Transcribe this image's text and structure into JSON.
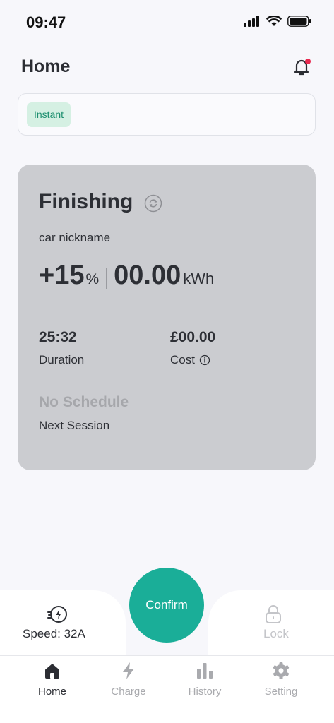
{
  "status_bar": {
    "time": "09:47"
  },
  "header": {
    "title": "Home"
  },
  "mode": {
    "chip_label": "Instant"
  },
  "card": {
    "status": "Finishing",
    "car_nickname": "car nickname",
    "percent_value": "+15",
    "percent_unit": "%",
    "energy_value": "00.00",
    "energy_unit": "kWh",
    "duration_value": "25:32",
    "duration_label": "Duration",
    "cost_value": "£00.00",
    "cost_label": "Cost",
    "schedule_value": "No Schedule",
    "schedule_label": "Next Session"
  },
  "actions": {
    "speed_label": "Speed: 32A",
    "confirm_label": "Confirm",
    "lock_label": "Lock"
  },
  "tabs": [
    {
      "label": "Home",
      "icon": "home-icon",
      "active": true
    },
    {
      "label": "Charge",
      "icon": "bolt-icon",
      "active": false
    },
    {
      "label": "History",
      "icon": "bar-chart-icon",
      "active": false
    },
    {
      "label": "Setting",
      "icon": "gear-icon",
      "active": false
    }
  ],
  "colors": {
    "accent": "#1aae98",
    "chip_bg": "#d5f0e3",
    "card_bg": "#cbccd0",
    "notification_dot": "#e8294f"
  }
}
